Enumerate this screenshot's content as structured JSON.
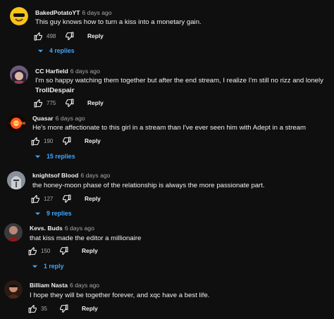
{
  "actions": {
    "reply_label": "Reply"
  },
  "comments": [
    {
      "author": "BakedPotatoYT",
      "time": "6 days ago",
      "text": "This guy knows how to turn a kiss into a monetary gain.",
      "likes": "498",
      "replies": "4 replies",
      "avatar_icon": "emoji-face-icon"
    },
    {
      "author": "CC Harfield",
      "time": "6 days ago",
      "text": "I'm so happy watching them together but after the end stream, I realize I'm still no rizz and lonely",
      "text_bold": "TrollDespair",
      "likes": "775",
      "avatar_icon": "anime-character-icon"
    },
    {
      "author": "Quasar",
      "time": "6 days ago",
      "text": "He's more affectionate to this girl in a stream than I've ever seen him with Adept in a stream",
      "likes": "190",
      "replies": "15 replies",
      "avatar_icon": "quasar-glow-icon"
    },
    {
      "author": "knightsof Blood",
      "time": "6 days ago",
      "text": "the honey-moon phase of the relationship is always the more passionate part.",
      "likes": "127",
      "replies": "9 replies",
      "avatar_icon": "knight-icon"
    },
    {
      "author": "Kevs. Buds",
      "time": "6 days ago",
      "text": "that kiss made the editor a millionaire",
      "likes": "150",
      "replies": "1 reply",
      "avatar_icon": "dark-figure-icon"
    },
    {
      "author": "Billiam Nasta",
      "time": "6 days ago",
      "text": "I hope they will be together forever, and xqc have a best life.",
      "likes": "35",
      "avatar_icon": "portrait-icon"
    }
  ]
}
